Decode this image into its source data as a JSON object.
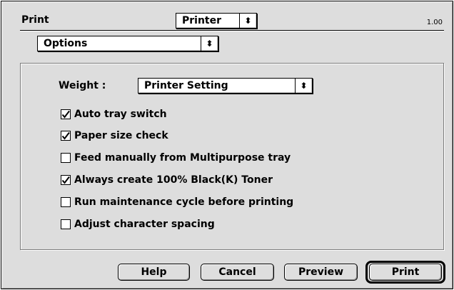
{
  "header": {
    "title": "Print",
    "printer_popup": "Printer",
    "version": "1.00"
  },
  "options_popup": "Options",
  "weight": {
    "label": "Weight :",
    "value": "Printer Setting"
  },
  "options": [
    {
      "label": "Auto tray switch",
      "checked": true
    },
    {
      "label": "Paper size check",
      "checked": true
    },
    {
      "label": "Feed manually from Multipurpose tray",
      "checked": false
    },
    {
      "label": "Always create 100% Black(K) Toner",
      "checked": true
    },
    {
      "label": "Run maintenance cycle before printing",
      "checked": false
    },
    {
      "label": "Adjust character spacing",
      "checked": false
    }
  ],
  "buttons": {
    "help": "Help",
    "cancel": "Cancel",
    "preview": "Preview",
    "print": "Print"
  },
  "icons": {
    "popup_arrows": "up-down-arrows-icon",
    "checkmark": "checkmark-icon"
  }
}
